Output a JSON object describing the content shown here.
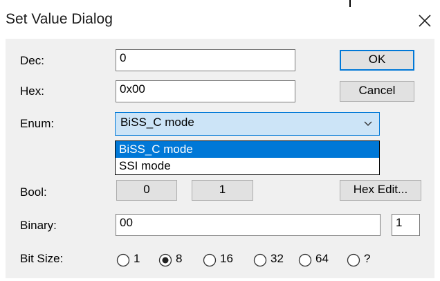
{
  "window": {
    "title": "Set Value Dialog",
    "close_icon": "close-icon"
  },
  "fields": {
    "dec": {
      "label": "Dec:",
      "value": "0"
    },
    "hex": {
      "label": "Hex:",
      "value": "0x00"
    },
    "enum": {
      "label": "Enum:",
      "selected": "BiSS_C mode",
      "options": [
        "BiSS_C mode",
        "SSI mode"
      ],
      "highlighted_index": 0,
      "arrow_icon": "chevron-down-icon"
    },
    "bool": {
      "label": "Bool:",
      "false_label": "0",
      "true_label": "1"
    },
    "binary": {
      "label": "Binary:",
      "value": "00",
      "bit_count": "1"
    },
    "bit_size": {
      "label": "Bit Size:",
      "options": [
        "1",
        "8",
        "16",
        "32",
        "64",
        "?"
      ],
      "selected": "8"
    }
  },
  "buttons": {
    "ok": "OK",
    "cancel": "Cancel",
    "hex_edit": "Hex Edit..."
  },
  "colors": {
    "accent": "#0078d7",
    "combo_bg": "#cce4f7",
    "client_bg": "#f0f0f0",
    "button_bg": "#e1e1e1"
  }
}
